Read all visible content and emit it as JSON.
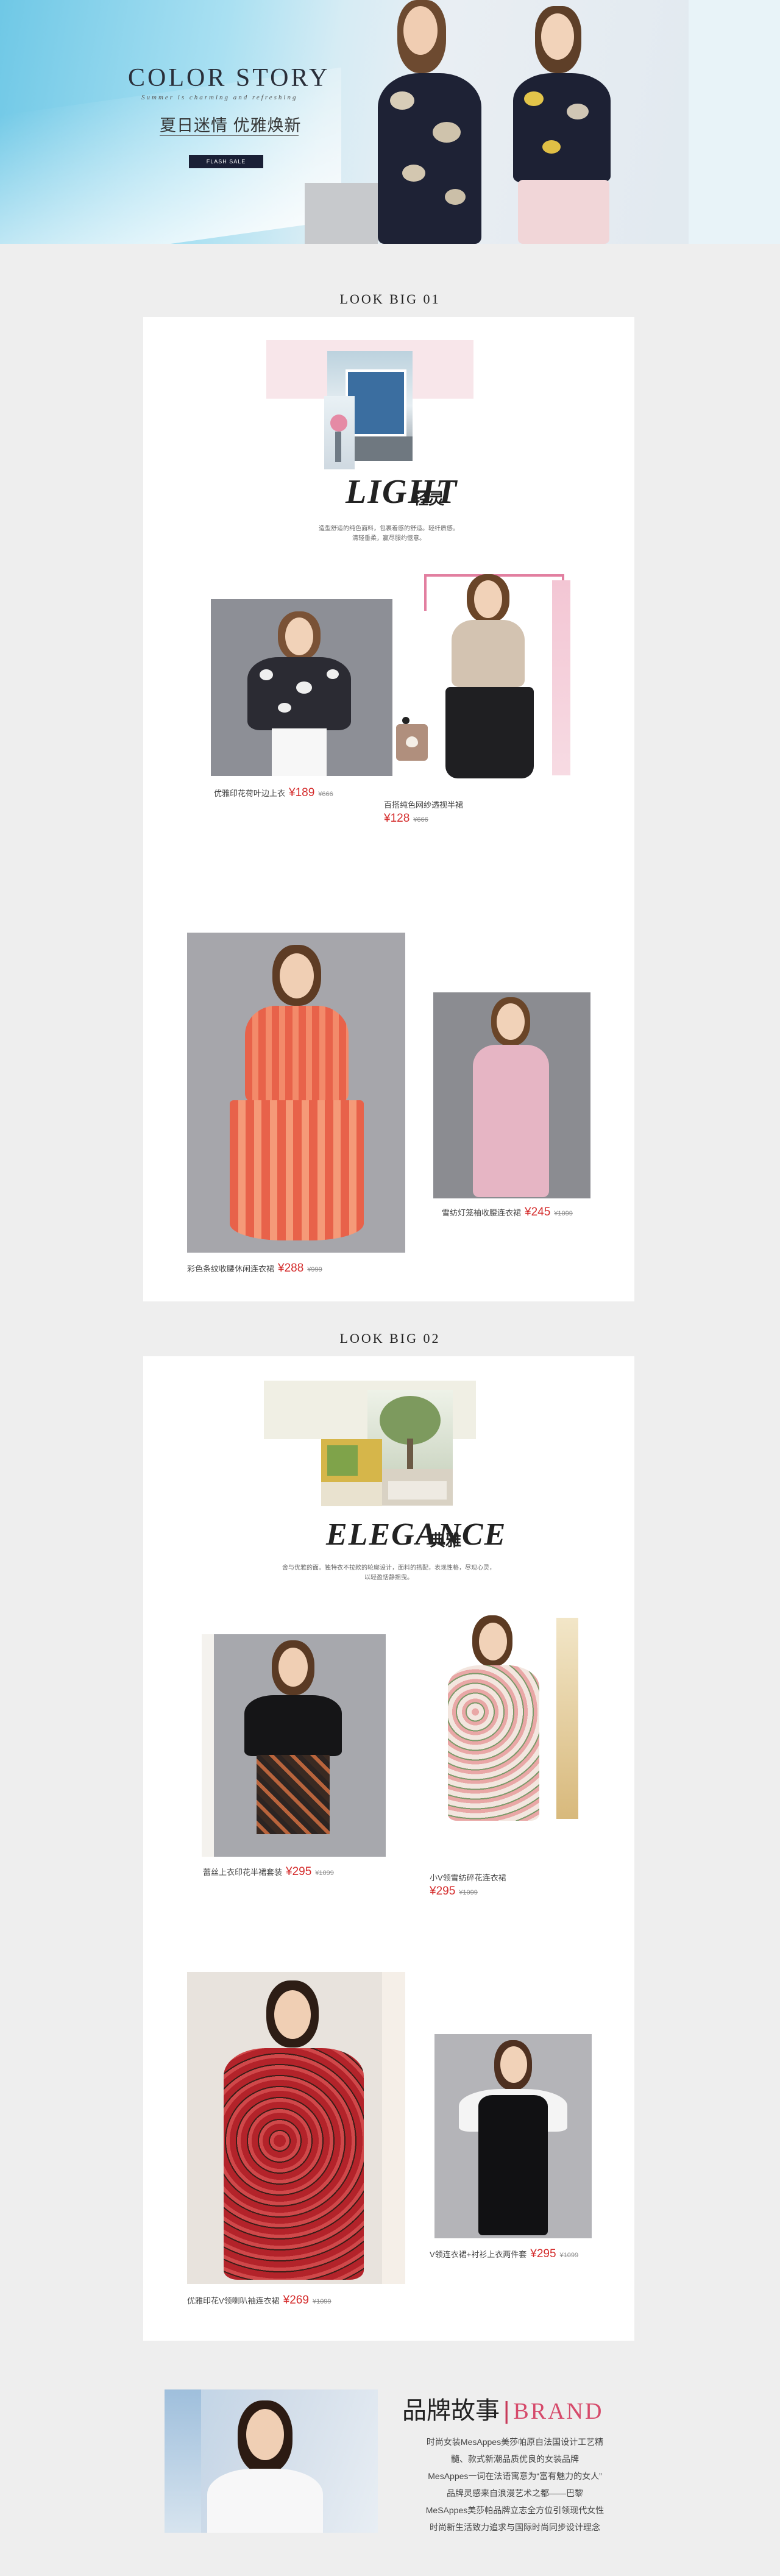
{
  "hero": {
    "title": "COLOR STORY",
    "subtitle": "Summer is charming and refreshing",
    "cn_title": "夏日迷情 优雅焕新",
    "button": "FLASH SALE"
  },
  "look1": {
    "section_title": "LOOK BIG 01",
    "word": "LIGHT",
    "word_cn": "轻灵",
    "intro": [
      "造型舒适的纯色面料，包裹着感的舒适。轻纤质感。",
      "清轻垂柔，赢尽服约惬意。"
    ],
    "products": [
      {
        "name": "优雅印花荷叶边上衣",
        "price": "¥189",
        "old": "¥666"
      },
      {
        "name": "百搭纯色网纱透视半裙",
        "price": "¥128",
        "old": "¥666"
      },
      {
        "name": "彩色条纹收腰休闲连衣裙",
        "price": "¥288",
        "old": "¥999"
      },
      {
        "name": "雪纺灯笼袖收腰连衣裙",
        "price": "¥245",
        "old": "¥1099"
      }
    ]
  },
  "look2": {
    "section_title": "LOOK BIG 02",
    "word": "ELEGANCE",
    "word_cn": "典雅",
    "intro": [
      "舍与优雅的面。独特衣不拉款的轮廓设计，面料的搭配，表现性格，尽现心灵，",
      "以轻盈恬静摇曳。"
    ],
    "products": [
      {
        "name": "蕾丝上衣印花半裙套装",
        "price": "¥295",
        "old": "¥1099"
      },
      {
        "name": "小V领雪纺碎花连衣裙",
        "price": "¥295",
        "old": "¥1099"
      },
      {
        "name": "优雅印花V领喇叭袖连衣裙",
        "price": "¥269",
        "old": "¥1099"
      },
      {
        "name": "V领连衣裙+衬衫上衣两件套",
        "price": "¥295",
        "old": "¥1099"
      }
    ]
  },
  "brand": {
    "title_cn": "品牌故事",
    "separator": "|",
    "title_en": "BRAND",
    "lines": [
      "时尚女装MesAppes美莎帕原自法国设计工艺精",
      "髓、款式新潮品质优良的女装品牌",
      "MesAppes一词在法语寓意为“富有魅力的女人”",
      "品牌灵感来自浪漫艺术之都——巴黎",
      "MeSAppes美莎帕品牌立志全方位引领现代女性",
      "时尚新生活致力追求与国际时尚同步设计理念"
    ]
  },
  "colors": {
    "price_red": "#d42b2b",
    "brand_pink": "#d64a6b",
    "page_bg": "#eeeeee",
    "hero_button": "#1a2036"
  }
}
